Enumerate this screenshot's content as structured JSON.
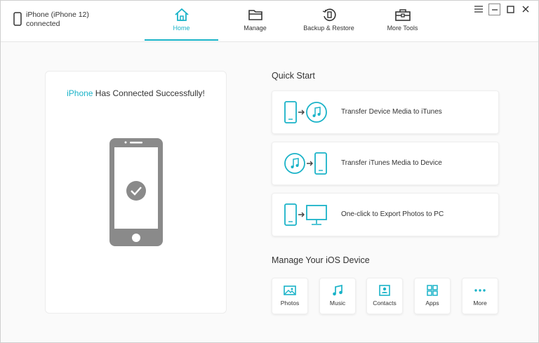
{
  "device": {
    "name": "iPhone (iPhone 12)",
    "status": "connected"
  },
  "nav": [
    {
      "label": "Home",
      "icon": "home-icon",
      "active": true
    },
    {
      "label": "Manage",
      "icon": "folder-icon"
    },
    {
      "label": "Backup & Restore",
      "icon": "backup-restore-icon"
    },
    {
      "label": "More Tools",
      "icon": "toolbox-icon"
    }
  ],
  "window_controls": [
    "menu-icon",
    "minimize-icon",
    "maximize-icon",
    "close-icon"
  ],
  "connection": {
    "device_word": "iPhone",
    "message": " Has Connected Successfully!"
  },
  "quick_start": {
    "title": "Quick Start",
    "items": [
      {
        "label": "Transfer Device Media to iTunes",
        "icon": "device-to-itunes-icon"
      },
      {
        "label": "Transfer iTunes Media to Device",
        "icon": "itunes-to-device-icon"
      },
      {
        "label": "One-click to Export Photos to PC",
        "icon": "export-photos-to-pc-icon"
      }
    ]
  },
  "manage": {
    "title": "Manage Your iOS Device",
    "items": [
      {
        "label": "Photos",
        "icon": "photos-icon"
      },
      {
        "label": "Music",
        "icon": "music-icon"
      },
      {
        "label": "Contacts",
        "icon": "contacts-icon"
      },
      {
        "label": "Apps",
        "icon": "apps-icon"
      },
      {
        "label": "More",
        "icon": "more-icon"
      }
    ]
  },
  "colors": {
    "accent": "#1ab3c8",
    "phone_gray": "#8a8a8a"
  }
}
